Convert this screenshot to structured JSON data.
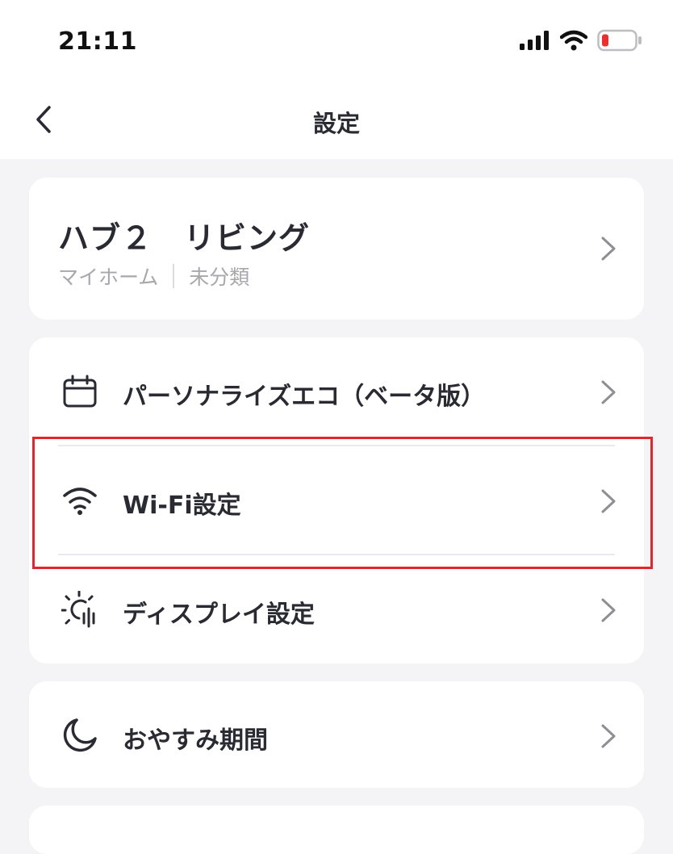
{
  "status_bar": {
    "time": "21:11",
    "icons": [
      "signal-icon",
      "wifi-icon",
      "battery-low-icon"
    ],
    "battery_color": "#e8302f"
  },
  "nav": {
    "title": "設定",
    "back_icon": "chevron-left-icon"
  },
  "device": {
    "name": "ハブ２　リビング",
    "home": "マイホーム",
    "category": "未分類"
  },
  "menu_group_1": [
    {
      "label": "パーソナライズエコ（ベータ版）",
      "icon": "calendar-icon"
    },
    {
      "label": "Wi-Fi設定",
      "icon": "wifi-icon"
    },
    {
      "label": "ディスプレイ設定",
      "icon": "display-sun-icon"
    }
  ],
  "menu_group_2": [
    {
      "label": "おやすみ期間",
      "icon": "moon-icon"
    }
  ],
  "colors": {
    "background": "#f4f4f6",
    "card": "#ffffff",
    "text": "#2a2a33",
    "subtext": "#a7a7ad",
    "highlight": "#e3262d"
  }
}
